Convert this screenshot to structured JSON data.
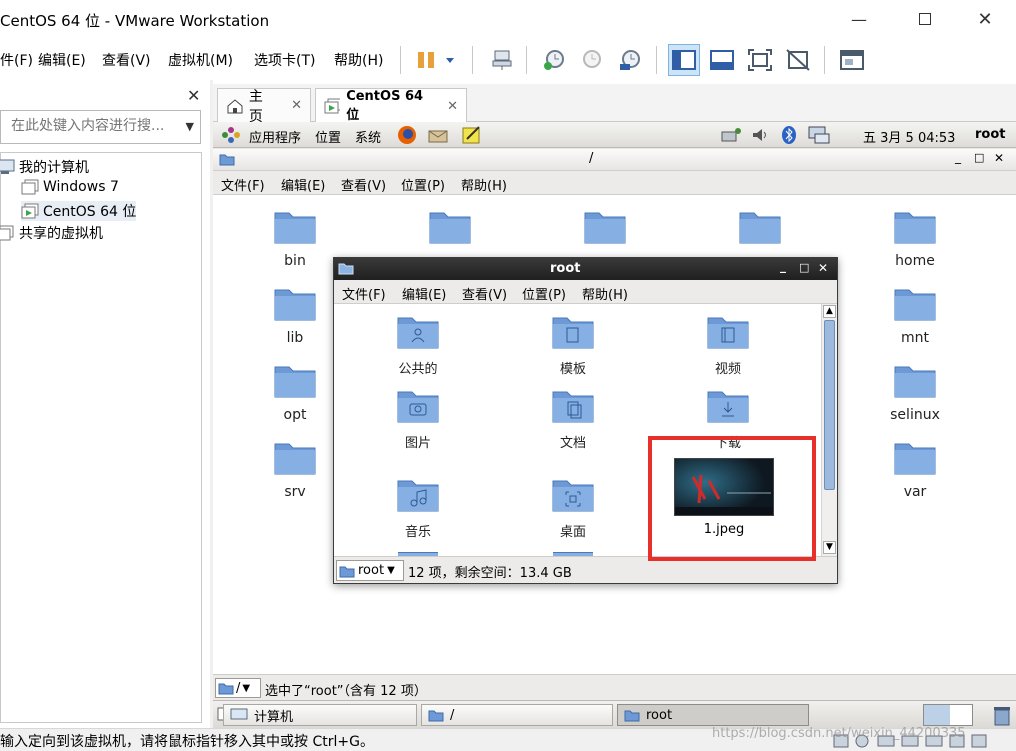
{
  "window": {
    "title": "CentOS 64 位 - VMware Workstation"
  },
  "menubar": {
    "items": [
      "件(F)",
      "编辑(E)",
      "查看(V)",
      "虚拟机(M)",
      "选项卡(T)",
      "帮助(H)"
    ]
  },
  "library": {
    "search_placeholder": "在此处键入内容进行搜...",
    "tree": {
      "my_computer": "我的计算机",
      "vm1": "Windows 7",
      "vm2": "CentOS 64 位",
      "shared": "共享的虚拟机"
    }
  },
  "tabs": {
    "home": "主页",
    "vm": "CentOS 64 位"
  },
  "guest": {
    "panel": {
      "applications": "应用程序",
      "places": "位置",
      "system": "系统",
      "clock": "五 3月  5 04:53",
      "user": "root"
    },
    "fm": {
      "path": "/",
      "menu": [
        "文件(F)",
        "编辑(E)",
        "查看(V)",
        "位置(P)",
        "帮助(H)"
      ],
      "folders": [
        "bin",
        "home",
        "lib",
        "mnt",
        "opt",
        "selinux",
        "srv",
        "var"
      ],
      "status_path": "/",
      "status_text": "选中了“root”（含有 12 项）"
    },
    "root_window": {
      "title": "root",
      "menu": [
        "文件(F)",
        "编辑(E)",
        "查看(V)",
        "位置(P)",
        "帮助(H)"
      ],
      "items": [
        "公共的",
        "模板",
        "视频",
        "图片",
        "文档",
        "下载",
        "音乐",
        "桌面",
        "1.jpeg"
      ],
      "location": "root",
      "status": "12 项，剩余空间：13.4 GB"
    },
    "taskbar": [
      "计算机",
      "/",
      "root"
    ]
  },
  "status_bar": {
    "message": "输入定向到该虚拟机，请将鼠标指针移入其中或按 Ctrl+G。",
    "watermark": "https://blog.csdn.net/weixin_44200335"
  },
  "colors": {
    "highlight_box": "#e8302b",
    "folder": "#6d9ad6"
  }
}
